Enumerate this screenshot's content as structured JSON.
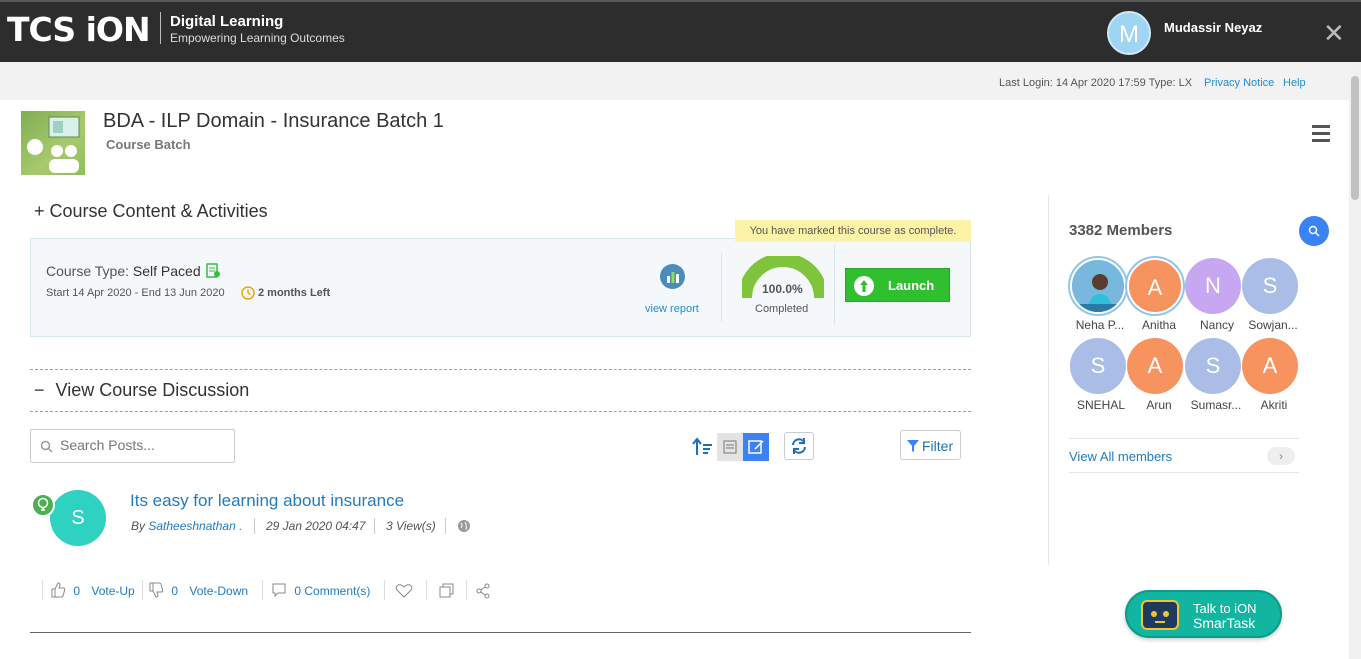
{
  "header": {
    "logo": "TCS iON",
    "tagline_title": "Digital Learning",
    "tagline_sub": "Empowering Learning Outcomes",
    "avatar_initial": "M",
    "user_name": "Mudassir Neyaz",
    "close_glyph": "✕"
  },
  "subbar": {
    "last_login": "Last Login: 14 Apr 2020 17:59 Type: LX",
    "privacy": "Privacy Notice",
    "help": "Help"
  },
  "course": {
    "title": "BDA - ILP Domain - Insurance Batch 1",
    "subtitle": "Course Batch"
  },
  "content_section": {
    "toggle": "+",
    "heading": "Course Content & Activities",
    "course_type_label": "Course Type: ",
    "course_type_value": "Self Paced",
    "dates": "Start 14 Apr 2020 - End  13 Jun 2020",
    "time_left": "2 months Left",
    "complete_note": "You have marked this course as complete.",
    "view_report": "view report",
    "progress_label": "100.0%",
    "progress_value": 100,
    "completed": "Completed",
    "launch": "Launch"
  },
  "discussion": {
    "toggle": "−",
    "heading": "View Course Discussion",
    "search_placeholder": "Search Posts...",
    "filter": "Filter",
    "post": {
      "avatar_initial": "S",
      "title": "Its easy for learning about insurance",
      "by_prefix": "By ",
      "author": "Satheeshnathan .",
      "date": "29 Jan 2020 04:47",
      "views": "3 View(s)",
      "vote_up_count": "0",
      "vote_up_label": "Vote-Up",
      "vote_down_count": "0",
      "vote_down_label": "Vote-Down",
      "comments": "0 Comment(s)"
    }
  },
  "members": {
    "count": "3382 Members",
    "list": [
      {
        "initial": "",
        "name": "Neha P...",
        "color": "#8fc6e8"
      },
      {
        "initial": "A",
        "name": "Anitha",
        "color": "#f7935f"
      },
      {
        "initial": "N",
        "name": "Nancy",
        "color": "#c7a6f2"
      },
      {
        "initial": "S",
        "name": "Sowjan...",
        "color": "#a9bde6"
      },
      {
        "initial": "S",
        "name": "SNEHAL",
        "color": "#a9bde6"
      },
      {
        "initial": "A",
        "name": "Arun",
        "color": "#f7935f"
      },
      {
        "initial": "S",
        "name": "Sumasr...",
        "color": "#a9bde6"
      },
      {
        "initial": "A",
        "name": "Akriti",
        "color": "#f7935f"
      }
    ],
    "view_all": "View All members"
  },
  "smartask": {
    "line1": "Talk to iON",
    "line2": "SmarTask"
  }
}
